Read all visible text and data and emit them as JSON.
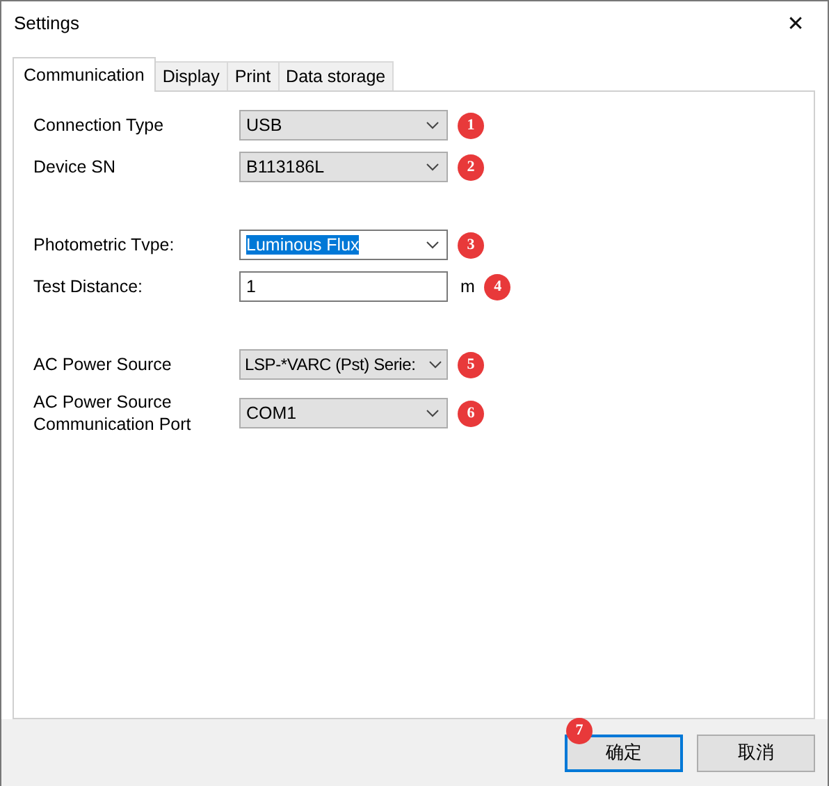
{
  "window": {
    "title": "Settings",
    "close": "✕"
  },
  "tabs": [
    {
      "label": "Communication",
      "selected": true
    },
    {
      "label": "Display",
      "selected": false
    },
    {
      "label": "Print",
      "selected": false
    },
    {
      "label": "Data storage",
      "selected": false
    }
  ],
  "sections": [
    {
      "fields": [
        {
          "label": "Connection Type",
          "kind": "select",
          "value": "USB",
          "highlighted": false,
          "marker": "1"
        },
        {
          "label": "Device SN",
          "kind": "select",
          "value": "B113186L",
          "highlighted": false,
          "marker": "2"
        }
      ]
    },
    {
      "fields": [
        {
          "label": "Photometric Tvpe:",
          "kind": "combo",
          "value": "Luminous Flux",
          "highlighted": true,
          "marker": "3"
        },
        {
          "label": "Test Distance:",
          "kind": "input",
          "value": "1",
          "unit": "m",
          "marker": "4"
        }
      ]
    },
    {
      "fields": [
        {
          "label": "AC Power Source",
          "kind": "select",
          "value": "LSP-*VARC (Pst) Serie:",
          "highlighted": false,
          "marker": "5"
        },
        {
          "label": "AC Power Source Communication Port",
          "kind": "select",
          "value": "COM1",
          "highlighted": false,
          "marker": "6"
        }
      ]
    }
  ],
  "buttons": [
    {
      "label": "确定",
      "default": true,
      "marker": "7"
    },
    {
      "label": "取消",
      "default": false
    }
  ]
}
